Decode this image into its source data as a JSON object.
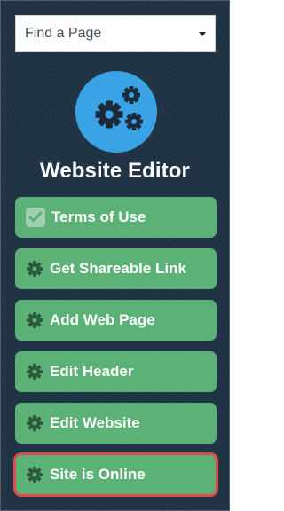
{
  "find_page": {
    "label": "Find a Page"
  },
  "header": {
    "logo_icon": "gears-icon",
    "title": "Website Editor"
  },
  "nav": {
    "items": [
      {
        "label": "Terms of Use",
        "icon": "check-icon"
      },
      {
        "label": "Get Shareable Link",
        "icon": "gear-icon"
      },
      {
        "label": "Add Web Page",
        "icon": "gear-icon"
      },
      {
        "label": "Edit Header",
        "icon": "gear-icon"
      },
      {
        "label": "Edit Website",
        "icon": "gear-icon"
      },
      {
        "label": "Site is Online",
        "icon": "gear-icon"
      }
    ]
  },
  "colors": {
    "background": "#1f3346",
    "button": "#5cb176",
    "logo_circle": "#3aa3e6",
    "highlight_border": "#e34b4b"
  }
}
